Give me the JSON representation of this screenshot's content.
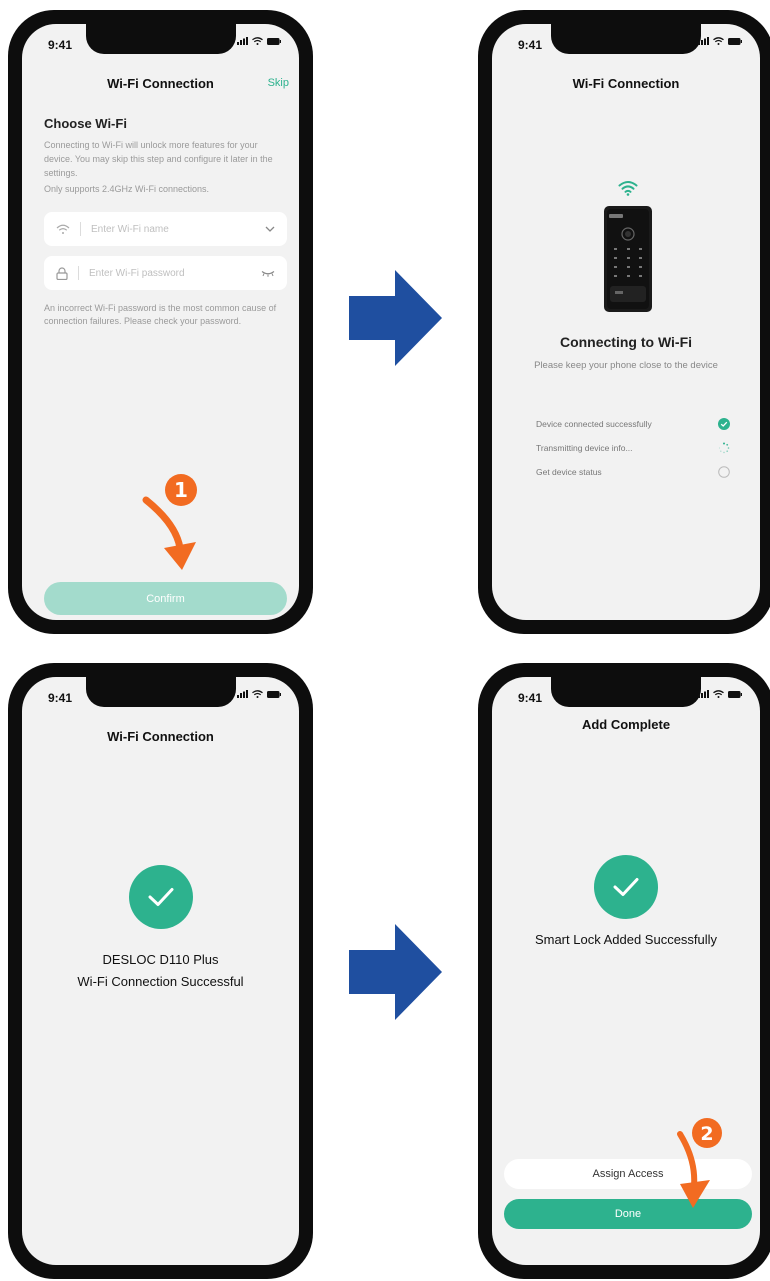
{
  "colors": {
    "accent": "#2db28e",
    "confirm_disabled": "#a3dbcc",
    "arrow_blue": "#1f4fa0",
    "annotation_orange": "#f26b21"
  },
  "status": {
    "time": "9:41"
  },
  "screen1": {
    "title": "Wi-Fi Connection",
    "skip": "Skip",
    "heading": "Choose Wi-Fi",
    "description": "Connecting to Wi-Fi will unlock more features for your device. You  may skip this step and configure it later in the settings.",
    "note": "Only supports 2.4GHz Wi-Fi connections.",
    "wifi_name_placeholder": "Enter Wi-Fi name",
    "wifi_password_placeholder": "Enter Wi-Fi password",
    "hint": "An incorrect Wi-Fi password is the most common cause of connection failures. Please check your password.",
    "confirm": "Confirm",
    "icons": [
      "wifi-icon",
      "chevron-down-icon",
      "lock-icon",
      "eye-closed-icon"
    ]
  },
  "screen2": {
    "title": "Wi-Fi Connection",
    "heading": "Connecting to Wi-Fi",
    "subtitle": "Please keep your phone close to the device",
    "steps": [
      {
        "label": "Device connected successfully",
        "state": "done"
      },
      {
        "label": "Transmitting device info...",
        "state": "loading"
      },
      {
        "label": "Get device status",
        "state": "pending"
      }
    ]
  },
  "screen3": {
    "title": "Wi-Fi Connection",
    "line1": "DESLOC D110 Plus",
    "line2": "Wi-Fi Connection Successful"
  },
  "screen4": {
    "title": "Add Complete",
    "message": "Smart Lock Added Successfully",
    "assign": "Assign Access",
    "done": "Done"
  },
  "annotations": {
    "step1": "1",
    "step2": "2"
  }
}
